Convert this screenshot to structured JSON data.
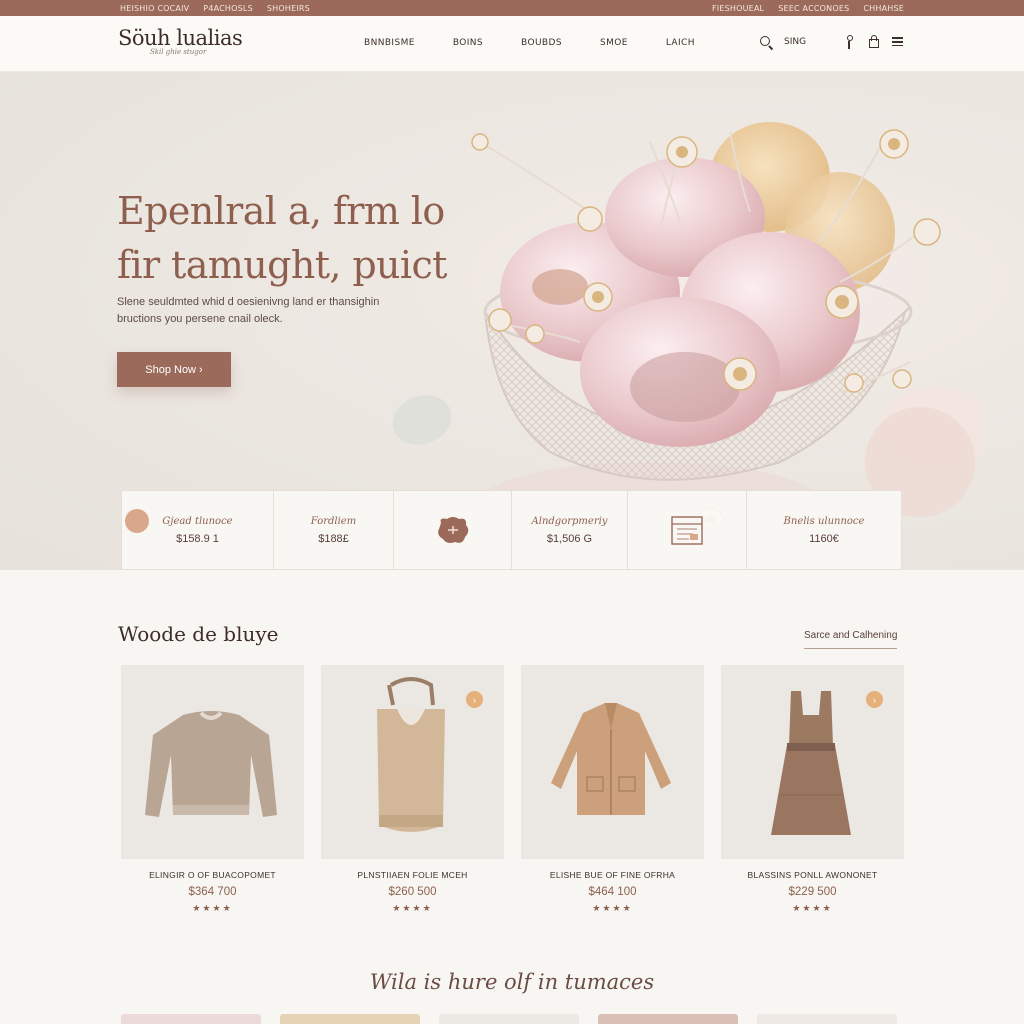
{
  "topbar": {
    "left": [
      "HEISHIO COCAIV",
      "P4ACHOSLS",
      "SHOHEIRS"
    ],
    "right": [
      "FIESHOUEAL",
      "SEEC ACCONOES",
      "CHHAHSE"
    ]
  },
  "header": {
    "logo": "Söuh lualias",
    "logo_sub": "Skil ghie stugor",
    "nav": [
      "BNNBISME",
      "BOINS",
      "BOUBDS",
      "SMOE",
      "LAICH"
    ],
    "sign": "SING"
  },
  "hero": {
    "title_line1": "Epenlral a, frm lo",
    "title_line2": "fir tamught, puict",
    "subtitle": "Slene seuldmted whid d oesienivng land er thansighin bructions you persene cnail oleck.",
    "button": "Shop Now ›"
  },
  "stats": [
    {
      "label": "Gjead tlunoce",
      "value": "$158.9 1",
      "icon": "dot-icon"
    },
    {
      "label": "Fordliem",
      "value": "$188£",
      "icon": ""
    },
    {
      "label": "",
      "value": "",
      "icon": "blob-icon"
    },
    {
      "label": "Alndgorpmeriy",
      "value": "$1,506 G",
      "icon": ""
    },
    {
      "label": "",
      "value": "",
      "icon": "calendar-icon"
    },
    {
      "label": "Bnelis ulunnoce",
      "value": "1160€",
      "icon": ""
    }
  ],
  "featured": {
    "title": "Woode de bluye",
    "link": "Sarce and Calhening",
    "products": [
      {
        "name": "ELINGIR O OF BUACOPOMET",
        "price": "$364 700",
        "stars": "★★★★",
        "badge": "",
        "kind": "sweater"
      },
      {
        "name": "PLNSTIIAEN FOLIE MCEH",
        "price": "$260 500",
        "stars": "★★★★",
        "badge": "›",
        "kind": "tote"
      },
      {
        "name": "ELISHE BUE OF FINE OFRHA",
        "price": "$464 100",
        "stars": "★★★★",
        "badge": "",
        "kind": "jacket"
      },
      {
        "name": "BLASSINS PONLL AWONONET",
        "price": "$229 500",
        "stars": "★★★★",
        "badge": "›",
        "kind": "dress"
      }
    ]
  },
  "bottom": {
    "title": "Wila is hure olf in tumaces"
  },
  "colors": {
    "accent": "#9b6a5a",
    "heading": "#8e5f4e",
    "background": "#f8f6f2",
    "badge": "#e6b07a"
  }
}
